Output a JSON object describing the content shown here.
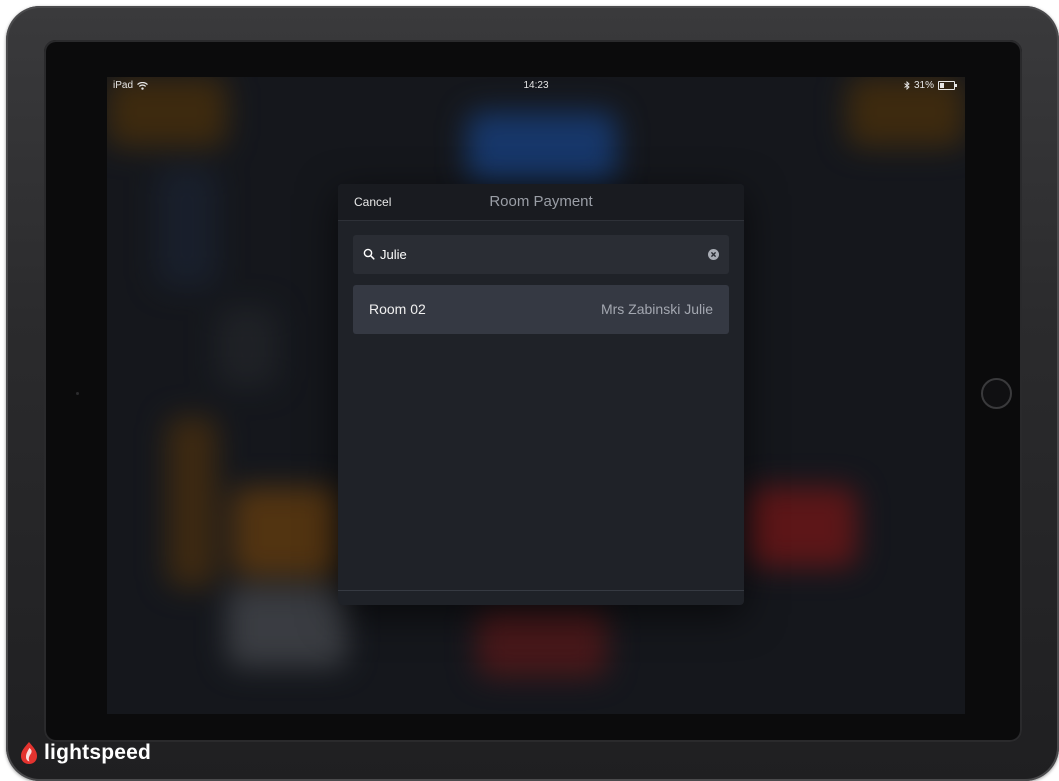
{
  "status_bar": {
    "device": "iPad",
    "time": "14:23",
    "battery": "31%",
    "battery_level": 0.31
  },
  "modal": {
    "cancel_label": "Cancel",
    "title": "Room Payment",
    "search": {
      "value": "Julie",
      "placeholder": ""
    },
    "results": [
      {
        "room": "Room 02",
        "guest": "Mrs Zabinski Julie"
      }
    ]
  },
  "brand": {
    "name": "lightspeed"
  },
  "icons": {
    "wifi": "wifi-icon",
    "bluetooth": "bluetooth-icon",
    "battery": "battery-icon",
    "search": "search-icon",
    "clear": "clear-icon",
    "logo": "flame-logo-icon"
  },
  "colors": {
    "modal_bg": "#1f2228",
    "row_bg": "#353943",
    "brand_red": "#e4332f"
  }
}
